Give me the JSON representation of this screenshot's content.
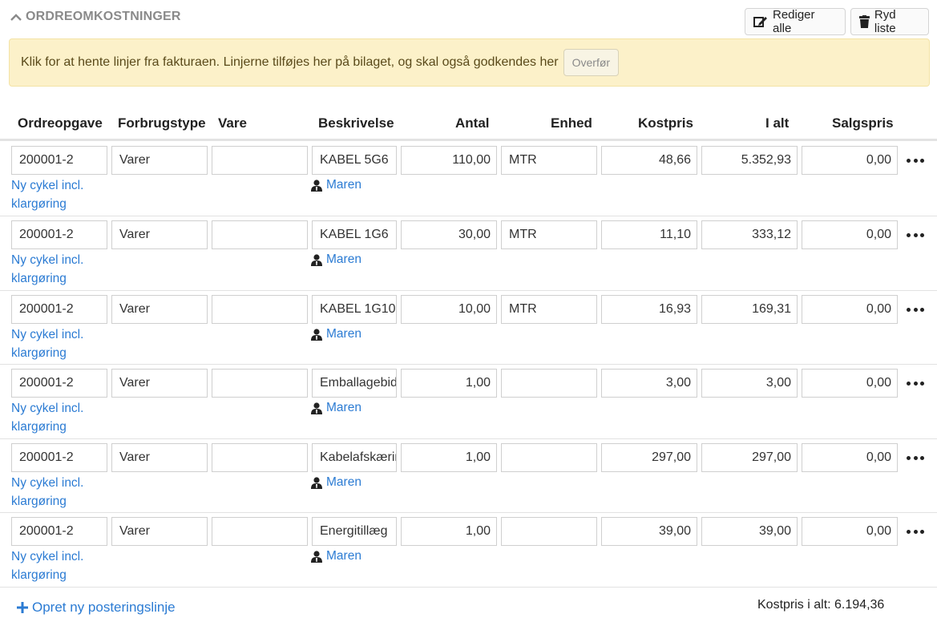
{
  "header": {
    "section_title": "ORDREOMKOSTNINGER",
    "edit_all_label": "Rediger alle",
    "clear_list_label": "Ryd liste"
  },
  "notice": {
    "text": "Klik for at hente linjer fra fakturaen. Linjerne tilføjes her på bilaget, og skal også godkendes her",
    "transfer_label": "Overfør"
  },
  "table": {
    "columns": [
      "Ordreopgave",
      "Forbrugstype",
      "Vare",
      "Beskrivelse",
      "Antal",
      "Enhed",
      "Kostpris",
      "I alt",
      "Salgspris"
    ],
    "rows": [
      {
        "ordreopgave": "200001-2",
        "forbrugstype": "Varer",
        "vare": "",
        "beskrivelse": "KABEL 5G6",
        "antal": "110,00",
        "enhed": "MTR",
        "kostpris": "48,66",
        "i_alt": "5.352,93",
        "salgspris": "0,00",
        "task_line1": "Ny cykel incl.",
        "task_line2": "klargøring",
        "person": "Maren"
      },
      {
        "ordreopgave": "200001-2",
        "forbrugstype": "Varer",
        "vare": "",
        "beskrivelse": "KABEL 1G6",
        "antal": "30,00",
        "enhed": "MTR",
        "kostpris": "11,10",
        "i_alt": "333,12",
        "salgspris": "0,00",
        "task_line1": "Ny cykel incl.",
        "task_line2": "klargøring",
        "person": "Maren"
      },
      {
        "ordreopgave": "200001-2",
        "forbrugstype": "Varer",
        "vare": "",
        "beskrivelse": "KABEL 1G10",
        "antal": "10,00",
        "enhed": "MTR",
        "kostpris": "16,93",
        "i_alt": "169,31",
        "salgspris": "0,00",
        "task_line1": "Ny cykel incl.",
        "task_line2": "klargøring",
        "person": "Maren"
      },
      {
        "ordreopgave": "200001-2",
        "forbrugstype": "Varer",
        "vare": "",
        "beskrivelse": "Emballagebidrag",
        "antal": "1,00",
        "enhed": "",
        "kostpris": "3,00",
        "i_alt": "3,00",
        "salgspris": "0,00",
        "task_line1": "Ny cykel incl.",
        "task_line2": "klargøring",
        "person": "Maren"
      },
      {
        "ordreopgave": "200001-2",
        "forbrugstype": "Varer",
        "vare": "",
        "beskrivelse": "Kabelafskæring",
        "antal": "1,00",
        "enhed": "",
        "kostpris": "297,00",
        "i_alt": "297,00",
        "salgspris": "0,00",
        "task_line1": "Ny cykel incl.",
        "task_line2": "klargøring",
        "person": "Maren"
      },
      {
        "ordreopgave": "200001-2",
        "forbrugstype": "Varer",
        "vare": "",
        "beskrivelse": "Energitillæg",
        "antal": "1,00",
        "enhed": "",
        "kostpris": "39,00",
        "i_alt": "39,00",
        "salgspris": "0,00",
        "task_line1": "Ny cykel incl.",
        "task_line2": "klargøring",
        "person": "Maren"
      }
    ]
  },
  "footer": {
    "new_line_label": "Opret ny posteringslinje",
    "total_text": "Kostpris i alt: 6.194,36"
  },
  "colors": {
    "link": "#2b7bd3",
    "notice_bg": "#fcf1c9",
    "muted_title": "#8a8a8a"
  },
  "icons": [
    "chevron-up-icon",
    "edit-icon",
    "trash-icon",
    "person-icon",
    "more-dots-icon",
    "plus-icon"
  ]
}
